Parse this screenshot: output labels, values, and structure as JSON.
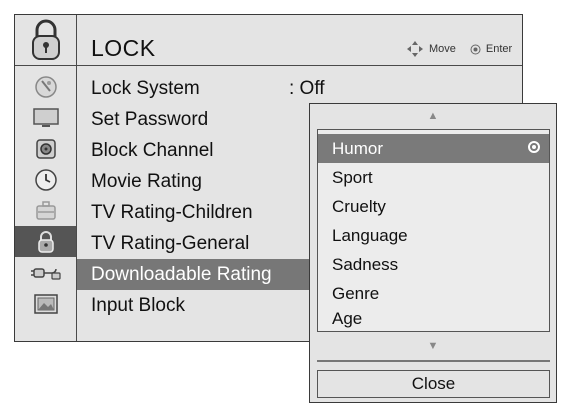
{
  "header": {
    "title": "LOCK",
    "icon": "padlock-icon",
    "hints": {
      "move_label": "Move",
      "enter_label": "Enter"
    }
  },
  "sidebar": {
    "icons": [
      "satellite-dish-icon",
      "monitor-icon",
      "speaker-icon",
      "clock-icon",
      "briefcase-icon",
      "padlock-icon",
      "plug-icon",
      "picture-frame-icon"
    ],
    "selected": "padlock-icon"
  },
  "menu": {
    "items": [
      {
        "label": "Lock System",
        "value": ": Off"
      },
      {
        "label": "Set Password"
      },
      {
        "label": "Block Channel"
      },
      {
        "label": "Movie Rating"
      },
      {
        "label": "TV Rating-Children"
      },
      {
        "label": "TV Rating-General"
      },
      {
        "label": "Downloadable Rating"
      },
      {
        "label": "Input Block"
      }
    ],
    "highlighted": "Downloadable Rating"
  },
  "popup": {
    "options": [
      "Humor",
      "Sport",
      "Cruelty",
      "Language",
      "Sadness",
      "Genre",
      "Age"
    ],
    "selected": "Humor",
    "close_label": "Close",
    "scroll_up": "up-arrow-icon",
    "scroll_down": "down-arrow-icon"
  },
  "colors": {
    "panel": "#e4e4e4",
    "highlight": "#777777",
    "selected_sidebar": "#555555",
    "border": "#3a3a3a"
  }
}
